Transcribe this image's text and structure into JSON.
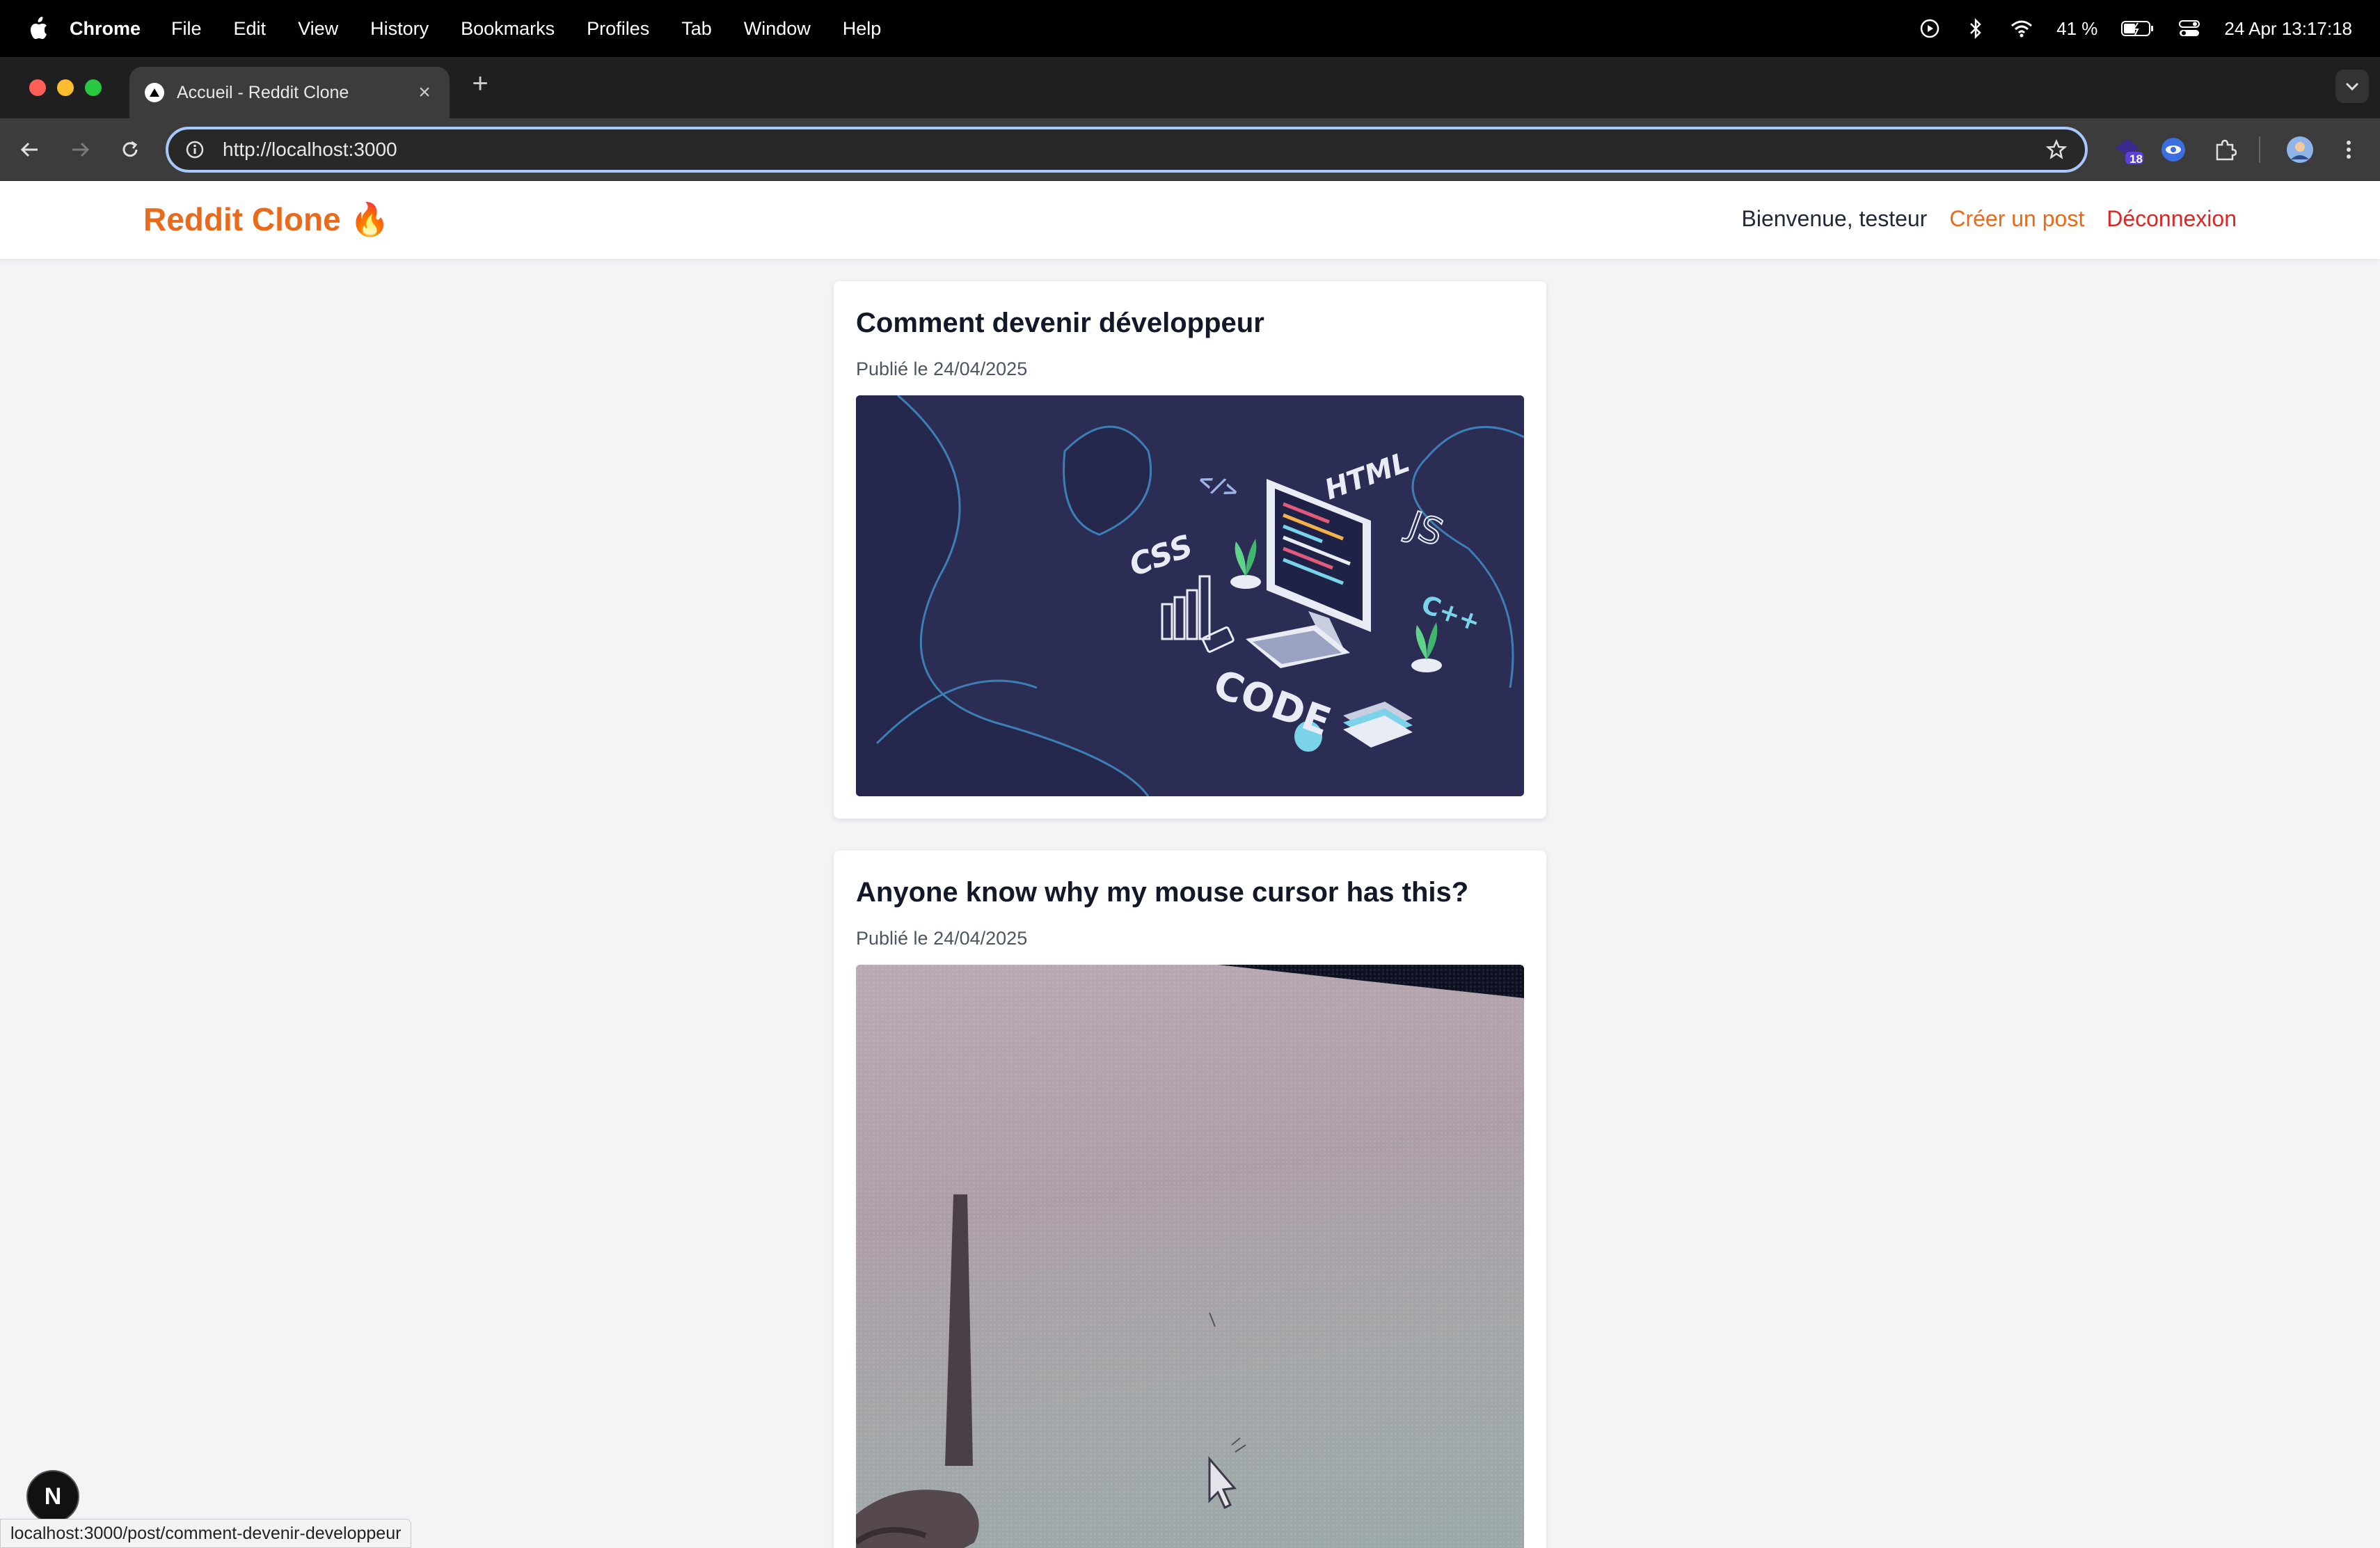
{
  "menubar": {
    "app_name": "Chrome",
    "items": [
      "File",
      "Edit",
      "View",
      "History",
      "Bookmarks",
      "Profiles",
      "Tab",
      "Window",
      "Help"
    ],
    "battery": "41 %",
    "datetime": "24 Apr  13:17:18"
  },
  "browser": {
    "tab_title": "Accueil - Reddit Clone",
    "url": "http://localhost:3000",
    "extension_badge": "18",
    "status_url": "localhost:3000/post/comment-devenir-developpeur"
  },
  "site": {
    "logo": "Reddit Clone 🔥",
    "welcome": "Bienvenue, testeur",
    "create_post": "Créer un post",
    "logout": "Déconnexion"
  },
  "posts": [
    {
      "title": "Comment devenir développeur",
      "date": "Publié le 24/04/2025",
      "image_labels": [
        "HTML",
        "CSS",
        "JS",
        "C++",
        "CODE",
        "</>"
      ]
    },
    {
      "title": "Anyone know why my mouse cursor has this?",
      "date": "Publié le 24/04/2025"
    }
  ],
  "dev_badge": "N",
  "colors": {
    "accent": "#ea6a1c",
    "danger": "#dc2626",
    "page_bg": "#f3f4f6"
  }
}
